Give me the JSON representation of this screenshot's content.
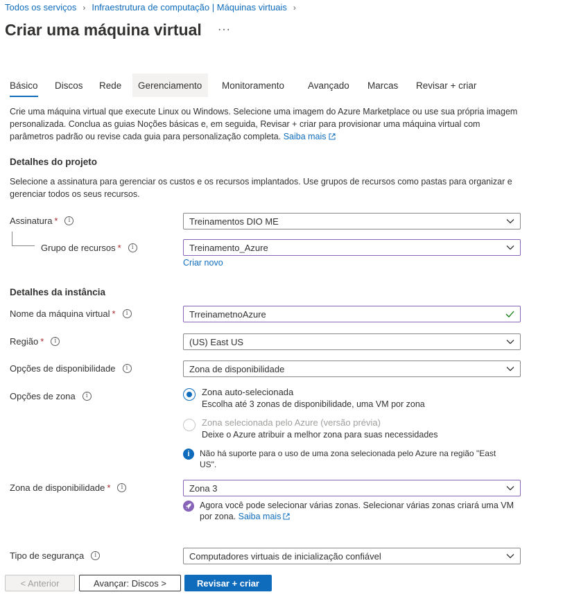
{
  "breadcrumb": {
    "items": [
      "Todos os serviços",
      "Infraestrutura de computação | Máquinas virtuais"
    ]
  },
  "page": {
    "title": "Criar uma máquina virtual",
    "more": "···"
  },
  "tabs": [
    {
      "label": "Básico"
    },
    {
      "label": "Discos"
    },
    {
      "label": "Rede"
    },
    {
      "label": "Gerenciamento"
    },
    {
      "label": "Monitoramento"
    },
    {
      "label": "Avançado"
    },
    {
      "label": "Marcas"
    },
    {
      "label": "Revisar + criar"
    }
  ],
  "intro": {
    "text": "Crie uma máquina virtual que execute Linux ou Windows. Selecione uma imagem do Azure Marketplace ou use sua própria imagem personalizada. Conclua as guias Noções básicas e, em seguida, Revisar + criar para provisionar uma máquina virtual com parâmetros padrão ou revise cada guia para personalização completa.",
    "link": "Saiba mais"
  },
  "project": {
    "title": "Detalhes do projeto",
    "description": "Selecione a assinatura para gerenciar os custos e os recursos implantados. Use grupos de recursos como pastas para organizar e gerenciar todos os seus recursos.",
    "subscription_label": "Assinatura",
    "subscription_value": "Treinamentos DIO ME",
    "resource_group_label": "Grupo de recursos",
    "resource_group_value": "Treinamento_Azure",
    "create_new": "Criar novo"
  },
  "instance": {
    "title": "Detalhes da instância",
    "vm_name_label": "Nome da máquina virtual",
    "vm_name_value": "TrreinametnoAzure",
    "region_label": "Região",
    "region_value": "(US) East US",
    "availability_label": "Opções de disponibilidade",
    "availability_value": "Zona de disponibilidade",
    "zone_options_label": "Opções de zona",
    "zone_option_1_title": "Zona auto-selecionada",
    "zone_option_1_sub": "Escolha até 3 zonas de disponibilidade, uma VM por zona",
    "zone_option_2_title": "Zona selecionada pelo Azure (versão prévia)",
    "zone_option_2_sub": "Deixe o Azure atribuir a melhor zona para suas necessidades",
    "zone_info_note": "Não há suporte para o uso de uma zona selecionada pelo Azure na região \"East US\".",
    "availability_zone_label": "Zona de disponibilidade",
    "availability_zone_value": "Zona 3",
    "multi_zone_note": "Agora você pode selecionar várias zonas. Selecionar várias zonas criará uma VM por zona.",
    "multi_zone_link": "Saiba mais",
    "security_type_label": "Tipo de segurança",
    "security_type_value": "Computadores virtuais de inicialização confiável"
  },
  "footer": {
    "prev": "< Anterior",
    "next": "Avançar: Discos >",
    "review": "Revisar + criar"
  },
  "colors": {
    "accent": "#0f6cbd",
    "required": "#a4262c",
    "focus_border": "#8764b8",
    "valid_check": "#107c10"
  }
}
